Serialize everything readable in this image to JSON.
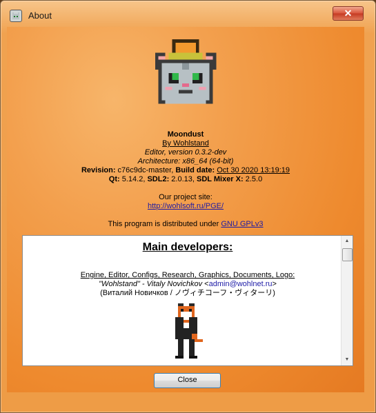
{
  "window": {
    "title": "About",
    "close_glyph": "✕"
  },
  "about": {
    "app_name": "Moondust",
    "by_author": "By Wohlstand",
    "editor_version": "Editor, version 0.3.2-dev",
    "architecture": "Architecture: x86_64 (64-bit)",
    "revision_label": "Revision:",
    "revision_value": "c76c9dc-master,",
    "build_date_label": "Build date:",
    "build_date_value": "Oct 30 2020 13:19:19",
    "qt_label": "Qt:",
    "qt_value": "5.14.2,",
    "sdl2_label": "SDL2:",
    "sdl2_value": "2.0.13,",
    "sdl_mixer_label": "SDL Mixer X:",
    "sdl_mixer_value": "2.5.0",
    "project_site_label": "Our project site:",
    "project_site_url": "http://wohlsoft.ru/PGE/",
    "license_text": "This program is distributed under",
    "license_link": "GNU GPLv3"
  },
  "developers": {
    "heading": "Main developers:",
    "roles": "Engine, Editor, Configs, Research, Graphics, Documents, Logo:",
    "dev_name": "\"Wohlstand\" - Vitaly Novichkov",
    "dev_email": "admin@wohlnet.ru",
    "dev_native": "(Виталий Новичков / ノヴィチコーフ・ヴィターリ)"
  },
  "buttons": {
    "close_label": "Close"
  },
  "icons": [
    "app-cat-icon",
    "close-icon",
    "scroll-up-icon",
    "scroll-down-icon"
  ],
  "colors": {
    "link": "#1c1aa6",
    "background_orange": "#ee9c46"
  }
}
